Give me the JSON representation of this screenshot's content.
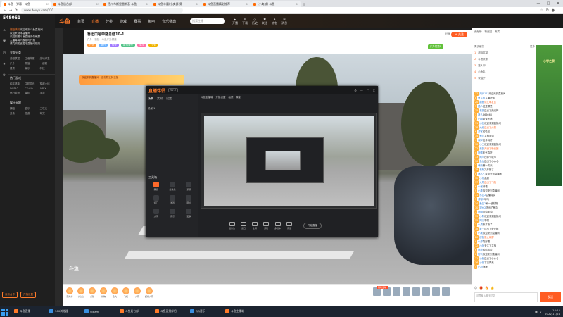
{
  "browser": {
    "tabs": [
      {
        "label": "斗鱼 - 弹幕 - 斗鱼"
      },
      {
        "label": "斗鱼后台部"
      },
      {
        "label": "德州布斯里雷斯基·斗鱼"
      },
      {
        "label": "斗鱼丰富(小卖部)第一"
      },
      {
        "label": "斗鱼直播精彩推荐"
      },
      {
        "label": "(小卖部) 斗鱼"
      }
    ],
    "url": "www.douyu.com/310",
    "window_controls": [
      "—",
      "□",
      "✕"
    ]
  },
  "sidebar": {
    "counter": "548061",
    "messages": [
      {
        "hl": "超级精彩",
        "text": "欢迎来到斗鱼直播间"
      },
      {
        "hl": "",
        "text": "欢迎来到本直播间"
      },
      {
        "hl": "",
        "text": "欢迎观看斗鱼直播请勿刷屏"
      },
      {
        "hl": "",
        "text": "主播每周六晚准时开播"
      },
      {
        "hl": "",
        "text": "请文明发言遵守直播间规则"
      }
    ],
    "section1": "全部分类",
    "grid1": [
      "英雄联盟",
      "王者荣耀",
      "绝地求生",
      "户外",
      "颜值",
      "一起看",
      "星秀",
      "娱乐",
      "科技"
    ],
    "section2": "热门游戏",
    "grid2": [
      "和平精英",
      "主机游戏",
      "穿越火线",
      "DOTA2",
      "CS:GO",
      "APEX",
      "怀旧游戏",
      "单机",
      "手游"
    ],
    "section3": "娱乐天地",
    "grid3": [
      "舞蹈",
      "音乐",
      "二次元",
      "美食",
      "旅游",
      "萌宠"
    ],
    "btn_left": "商务合作",
    "btn_right": "开播设置"
  },
  "header": {
    "logo": "斗鱼",
    "nav": [
      "首页",
      "直播",
      "分类",
      "游戏",
      "赛事",
      "鱼吧",
      "音乐盛典"
    ],
    "active_nav": "直播",
    "search_placeholder": "搜索主播",
    "icons": [
      "开播",
      "下载",
      "历史",
      "关注",
      "钱包",
      "消息"
    ]
  },
  "room": {
    "title": "鲁迅口哈带路总结10-1",
    "sub": "户外 · 街拍 · 斗鱼户外频道",
    "tags": [
      "户外",
      "旅行",
      "街头",
      "城市漫步",
      "实况",
      "打卡"
    ],
    "follow": "+ 关注",
    "share": "分享",
    "rank": "户外榜第1"
  },
  "video": {
    "banner": "欢迎来到直播间 · 送礼物支持主播",
    "watermark": "斗鱼"
  },
  "appwin": {
    "logo": "直播伴侣",
    "version": "V2.0",
    "tabs": [
      "场景",
      "素材",
      "设置"
    ],
    "scene": "场景 1",
    "tools_label": "工具箱",
    "tools": [
      "美颜",
      "摄像头",
      "录屏",
      "窗口",
      "游戏",
      "图片",
      "文字",
      "音乐",
      "更多"
    ],
    "topbar": [
      "斗鱼主播端",
      "开播设置",
      "画质",
      "录制"
    ],
    "bottom": [
      "摄像头",
      "窗口",
      "全屏",
      "游戏",
      "多媒体",
      "音量"
    ],
    "start": "开始直播"
  },
  "gifts": {
    "items": [
      "荧光棒",
      "小心心",
      "点赞",
      "礼物",
      "鱼丸",
      "飞机",
      "火箭",
      "超级火箭"
    ],
    "promo": "限时活动"
  },
  "rpanel": {
    "top_tabs": [
      "贡献榜",
      "粉丝团",
      "贵宾"
    ],
    "rank_title": "周贡献榜",
    "rank_more": "更多",
    "rank_rows": [
      {
        "n": "1",
        "name": "超级富豪"
      },
      {
        "n": "2",
        "name": "斗鱼玩家"
      },
      {
        "n": "3",
        "name": "路人甲"
      },
      {
        "n": "4",
        "name": "小鱼丸"
      },
      {
        "n": "5",
        "name": "夜猫子"
      }
    ],
    "ad_text": "小学之家",
    "chat": [
      {
        "lv": "12",
        "u": "用户123",
        "t": "欢迎来到直播间"
      },
      {
        "lv": "8",
        "u": "鱼丸君",
        "t": "主播好帅"
      },
      {
        "lv": "20",
        "u": "超管",
        "t": "请文明发言",
        "sys": true
      },
      {
        "lv": "5",
        "u": "路人",
        "t": "这是哪里"
      },
      {
        "lv": "15",
        "u": "老铁",
        "t": "送出了荧光棒"
      },
      {
        "lv": "3",
        "u": "新人",
        "t": "666666"
      },
      {
        "lv": "9",
        "u": "小明",
        "t": "街景不错"
      },
      {
        "lv": "11",
        "u": "水友",
        "t": "欢迎来到直播间"
      },
      {
        "lv": "18",
        "u": "大佬",
        "t": "送出了火箭",
        "sys": true
      },
      {
        "lv": "6",
        "u": "游客",
        "t": "哈哈哈"
      },
      {
        "lv": "14",
        "u": "鱼友",
        "t": "主播加油"
      },
      {
        "lv": "7",
        "u": "观众",
        "t": "这车真好"
      },
      {
        "lv": "10",
        "u": "小王",
        "t": "欢迎来到直播间"
      },
      {
        "lv": "22",
        "u": "贵族",
        "t": "开通了粉丝团",
        "sys": true
      },
      {
        "lv": "4",
        "u": "阿强",
        "t": "天气真好"
      },
      {
        "lv": "13",
        "u": "阿华",
        "t": "在哪个城市"
      },
      {
        "lv": "16",
        "u": "鱼丸",
        "t": "送出了小心心"
      },
      {
        "lv": "2",
        "u": "萌新",
        "t": "第一次来"
      },
      {
        "lv": "19",
        "u": "老粉",
        "t": "又开播了"
      },
      {
        "lv": "8",
        "u": "路人乙",
        "t": "欢迎来到直播间"
      },
      {
        "lv": "12",
        "u": "小刘",
        "t": "走起"
      },
      {
        "lv": "17",
        "u": "大哥",
        "t": "送出了飞机",
        "sys": true
      },
      {
        "lv": "6",
        "u": "小张",
        "t": "好看"
      },
      {
        "lv": "9",
        "u": "小李",
        "t": "欢迎来到直播间"
      },
      {
        "lv": "11",
        "u": "水友2",
        "t": "主播真实"
      },
      {
        "lv": "5",
        "u": "游客2",
        "t": "哈哈"
      },
      {
        "lv": "14",
        "u": "鱼友2",
        "t": "刷一波礼物"
      },
      {
        "lv": "10",
        "u": "观众2",
        "t": "送出了鱼丸"
      },
      {
        "lv": "7",
        "u": "阿明",
        "t": "加油加油"
      },
      {
        "lv": "13",
        "u": "小陈",
        "t": "欢迎来到直播间"
      },
      {
        "lv": "15",
        "u": "阿杰",
        "t": "牛啊"
      },
      {
        "lv": "3",
        "u": "小周",
        "t": "来了来了"
      },
      {
        "lv": "18",
        "u": "老王",
        "t": "送出了荧光棒"
      },
      {
        "lv": "4",
        "u": "小吴",
        "t": "欢迎来到直播间"
      },
      {
        "lv": "20",
        "u": "房管",
        "t": "禁止刷屏",
        "sys": true
      },
      {
        "lv": "9",
        "u": "小郑",
        "t": "真好看"
      },
      {
        "lv": "12",
        "u": "小孙",
        "t": "关注了主播"
      },
      {
        "lv": "6",
        "u": "阿亮",
        "t": "哈哈哈哈"
      },
      {
        "lv": "8",
        "u": "阿飞",
        "t": "欢迎来到直播间"
      },
      {
        "lv": "11",
        "u": "小赵",
        "t": "送出了小心心"
      },
      {
        "lv": "16",
        "u": "小钱",
        "t": "下次再来"
      },
      {
        "lv": "5",
        "u": "小冯",
        "t": "拜拜"
      }
    ],
    "emoji": [
      "😊",
      "🎁",
      "🔥",
      "👍"
    ],
    "chat_placeholder": "这里输入聊天内容",
    "send": "发送"
  },
  "taskbar": {
    "items": [
      {
        "label": "斗鱼直播",
        "blue": false
      },
      {
        "label": "360浏览器",
        "blue": true
      },
      {
        "label": "Steam",
        "blue": true
      },
      {
        "label": "斗鱼后台部",
        "blue": false
      },
      {
        "label": "斗鱼直播伴侣",
        "blue": false
      },
      {
        "label": "QQ音乐",
        "blue": true
      },
      {
        "label": "斗鱼主播端",
        "blue": false
      }
    ],
    "time": "14:15",
    "date": "2022/11/24"
  }
}
